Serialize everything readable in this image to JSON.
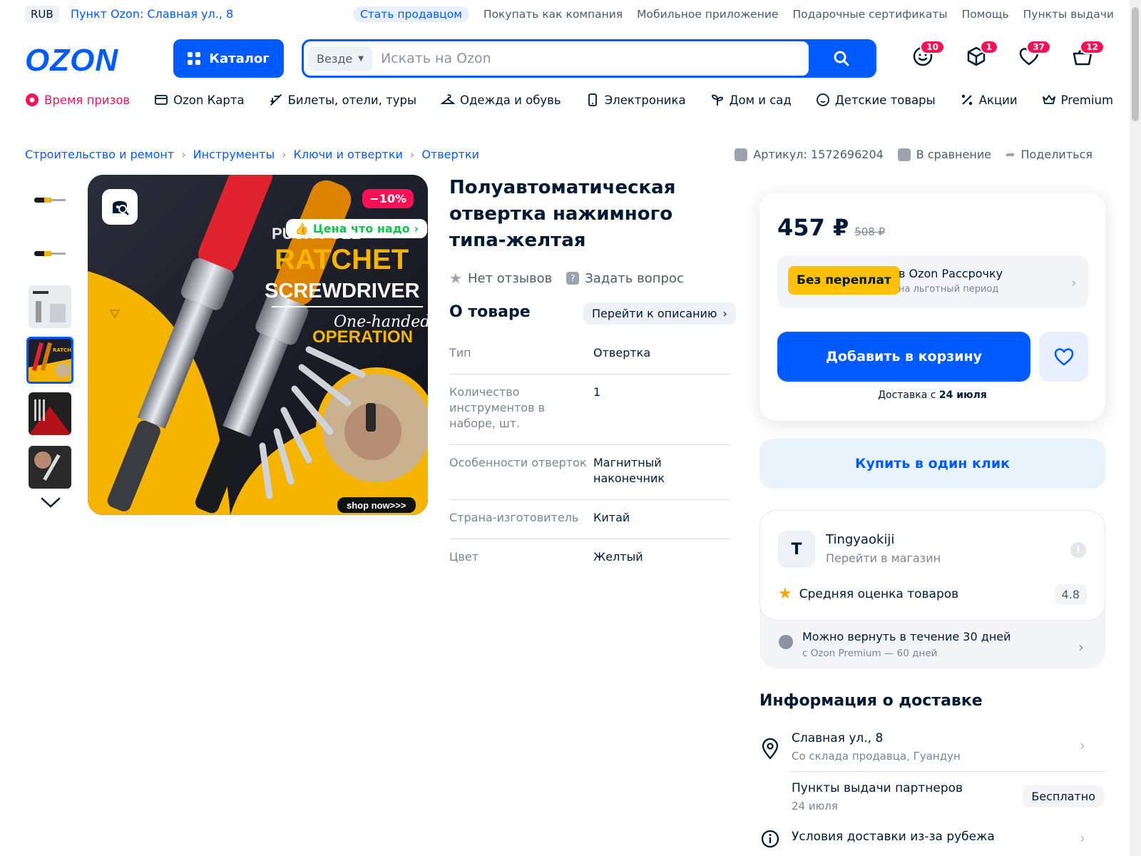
{
  "topbar": {
    "currency": "RUB",
    "pickup_point": "Пункт Ozon: Славная ул., 8",
    "links": [
      "Стать продавцом",
      "Покупать как компания",
      "Мобильное приложение",
      "Подарочные сертификаты",
      "Помощь",
      "Пункты выдачи"
    ]
  },
  "header": {
    "logo": "OZON",
    "catalog_label": "Каталог",
    "search_scope": "Везде",
    "search_placeholder": "Искать на Ozon",
    "badges": {
      "profile": "10",
      "orders": "1",
      "favorites": "37",
      "cart": "12"
    }
  },
  "nav": {
    "items": [
      "Время призов",
      "Ozon Карта",
      "Билеты, отели, туры",
      "Одежда и обувь",
      "Электроника",
      "Дом и сад",
      "Детские товары",
      "Акции",
      "Premium"
    ]
  },
  "breadcrumbs": [
    "Строительство и ремонт",
    "Инструменты",
    "Ключи и отвертки",
    "Отвертки"
  ],
  "meta": {
    "article": "Артикул: 1572696204",
    "compare": "В сравнение",
    "share": "Поделиться"
  },
  "product": {
    "title": "Полуавтоматическая отвертка нажимного типа-желтая",
    "discount": "−10%",
    "price_tag": "Цена что надо",
    "image_texts": {
      "line1": "PUSH PULL",
      "line2": "RATCHET",
      "line3": "SCREWDRIVER",
      "line4": "One-handed",
      "line5": "OPERATION",
      "footer": "shop now>>>"
    },
    "reviews": "Нет отзывов",
    "ask": "Задать вопрос"
  },
  "about": {
    "heading": "О товаре",
    "goto_label": "Перейти к описанию",
    "specs": [
      {
        "k": "Тип",
        "v": "Отвертка"
      },
      {
        "k": "Количество инструментов в наборе, шт.",
        "v": "1"
      },
      {
        "k": "Особенности отверток",
        "v": "Магнитный наконечник"
      },
      {
        "k": "Страна-изготовитель",
        "v": "Китай"
      },
      {
        "k": "Цвет",
        "v": "Желтый"
      }
    ]
  },
  "buy": {
    "price": "457 ₽",
    "old_price": "508 ₽",
    "installment_pill": "Без переплат",
    "installment_title": "в Ozon Рассрочку",
    "installment_sub": "на льготный период",
    "add_to_cart": "Добавить в корзину",
    "delivery_prefix": "Доставка с",
    "delivery_date": "24 июля",
    "one_click": "Купить в один клик"
  },
  "seller": {
    "avatar_letter": "T",
    "name": "Tingyaokiji",
    "link": "Перейти в магазин",
    "rating_label": "Средняя оценка товаров",
    "rating_value": "4.8",
    "return_title": "Можно вернуть в течение 30 дней",
    "return_sub": "с Ozon Premium — 60 дней"
  },
  "delivery": {
    "heading": "Информация о доставке",
    "address": "Славная ул., 8",
    "address_sub": "Со склада продавца, Гуандун",
    "partners": "Пункты выдачи партнеров",
    "partners_date": "24 июля",
    "free": "Бесплатно",
    "abroad": "Условия доставки из-за рубежа"
  },
  "colors": {
    "brand": "#005bff",
    "accent": "#f91155",
    "yellow": "#ffc107"
  }
}
